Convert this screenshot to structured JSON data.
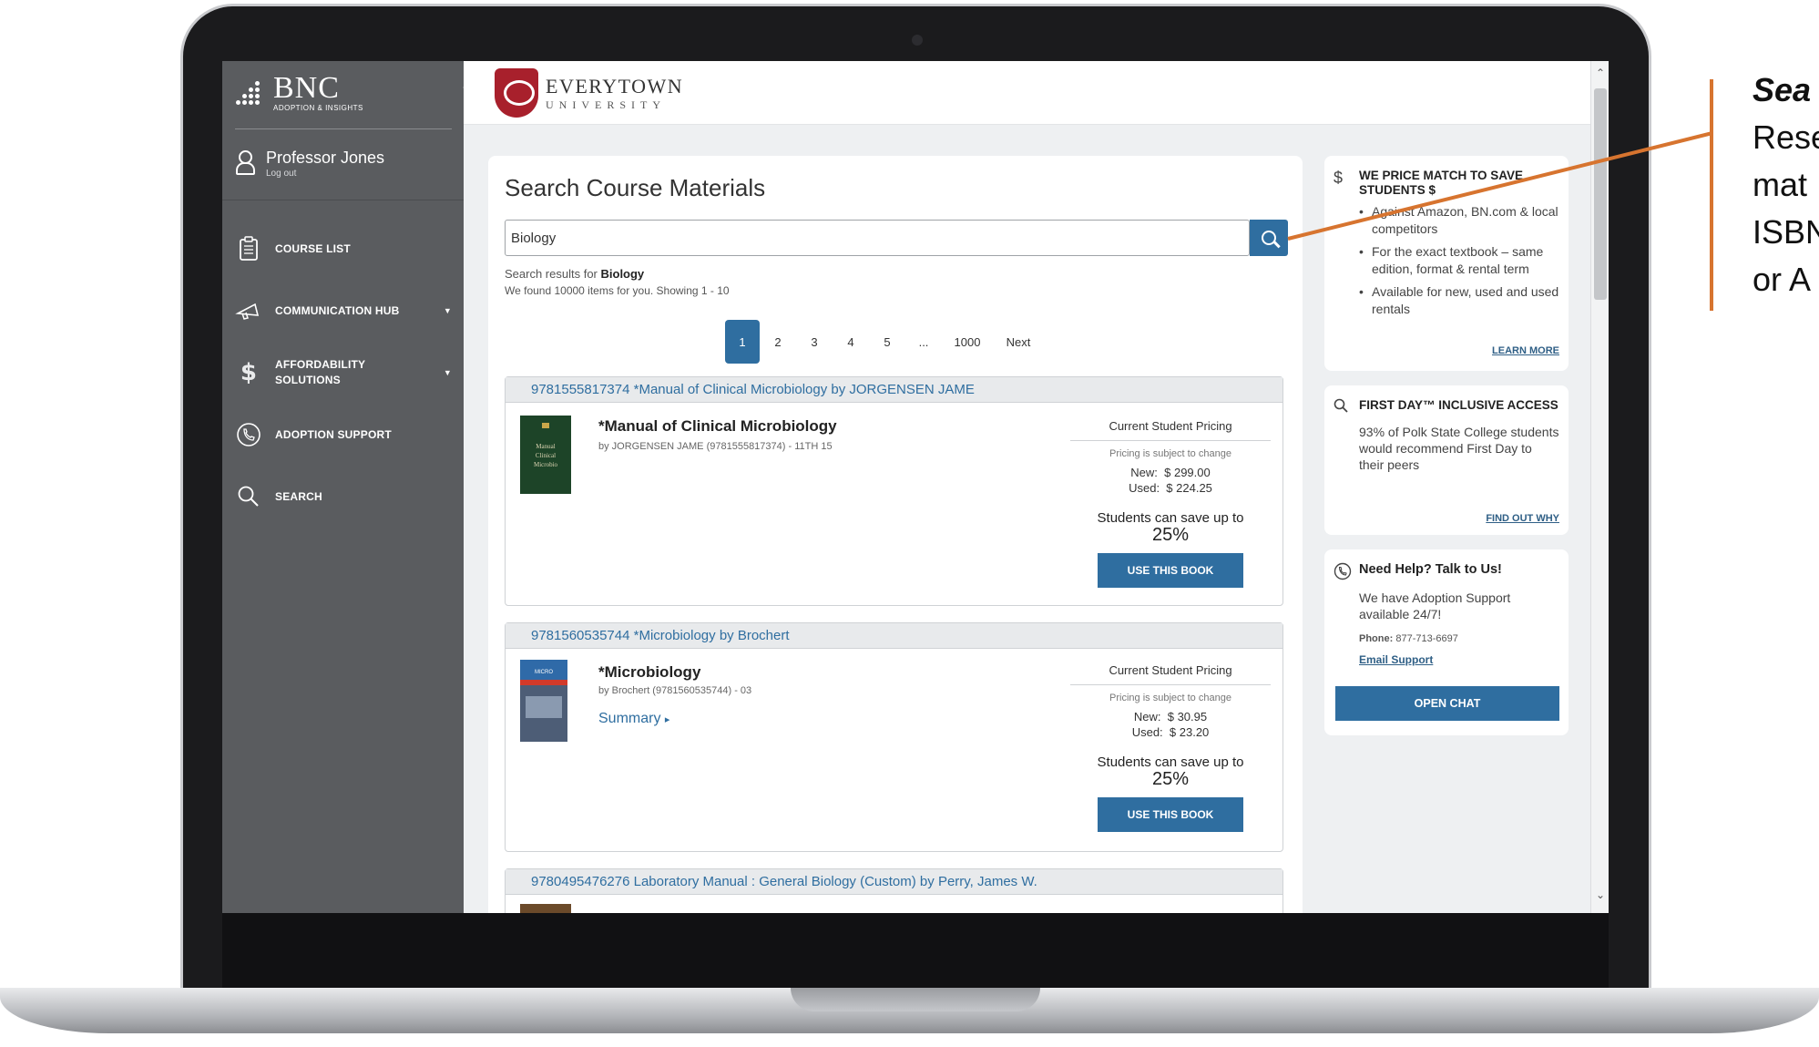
{
  "sidebar": {
    "brand": {
      "name": "BNC",
      "tagline": "ADOPTION & INSIGHTS"
    },
    "user": {
      "name": "Professor Jones",
      "logout": "Log out"
    },
    "items": [
      {
        "label": "COURSE LIST",
        "icon": "clipboard-icon"
      },
      {
        "label": "COMMUNICATION HUB",
        "icon": "megaphone-icon",
        "caret": "▼"
      },
      {
        "label": "AFFORDABILITY SOLUTIONS",
        "icon": "dollar-icon",
        "caret": "▼"
      },
      {
        "label": "ADOPTION SUPPORT",
        "icon": "phone-icon"
      },
      {
        "label": "SEARCH",
        "icon": "search-icon"
      }
    ]
  },
  "header": {
    "university_name": "EVERYTOWN",
    "university_sub": "UNIVERSITY"
  },
  "main": {
    "title": "Search Course Materials",
    "search_value": "Biology",
    "results_prefix": "Search results for",
    "results_term": "Biology",
    "count_text": "We found 10000 items for you. Showing 1 - 10",
    "pagination": [
      "1",
      "2",
      "3",
      "4",
      "5",
      "...",
      "1000",
      "Next"
    ],
    "active_page": "1",
    "results": [
      {
        "header": "9781555817374 *Manual of Clinical Microbiology by JORGENSEN JAME",
        "title": "*Manual of Clinical Microbiology",
        "byline": "by JORGENSEN JAME (9781555817374) - 11TH 15",
        "pricing_title": "Current Student Pricing",
        "pricing_note": "Pricing is subject to change",
        "new_label": "New:",
        "new_price": "$ 299.00",
        "used_label": "Used:",
        "used_price": "$ 224.25",
        "save_text": "Students can save up to",
        "save_pct": "25%",
        "button": "USE THIS BOOK"
      },
      {
        "header": "9781560535744 *Microbiology by Brochert",
        "title": "*Microbiology",
        "byline": "by Brochert (9781560535744) - 03",
        "summary": "Summary",
        "pricing_title": "Current Student Pricing",
        "pricing_note": "Pricing is subject to change",
        "new_label": "New:",
        "new_price": "$ 30.95",
        "used_label": "Used:",
        "used_price": "$ 23.20",
        "save_text": "Students can save up to",
        "save_pct": "25%",
        "button": "USE THIS BOOK"
      },
      {
        "header": "9780495476276 Laboratory Manual : General Biology (Custom) by Perry, James W."
      }
    ]
  },
  "right": {
    "price_match": {
      "title": "WE PRICE MATCH TO SAVE STUDENTS $",
      "bullets": [
        "Against Amazon, BN.com & local competitors",
        "For the exact textbook – same edition, format & rental term",
        "Available for new, used and used rentals"
      ],
      "link": "LEARN MORE"
    },
    "first_day": {
      "title": "FIRST DAY™ INCLUSIVE ACCESS",
      "body": "93% of Polk State College students would recommend First Day to their peers",
      "link": "FIND OUT WHY"
    },
    "help": {
      "title": "Need Help? Talk to Us!",
      "body": "We have Adoption Support available 24/7!",
      "phone_label": "Phone:",
      "phone": "877-713-6697",
      "email_link": "Email Support",
      "chat_button": "OPEN CHAT"
    }
  },
  "annotation": {
    "lines": [
      "Sea",
      "Rese",
      "mat",
      "ISBN",
      "or A"
    ]
  },
  "colors": {
    "accent": "#2f6ea0",
    "sidebar": "#5a5c5f",
    "annotation": "#d7742f",
    "crest": "#a8202c"
  }
}
